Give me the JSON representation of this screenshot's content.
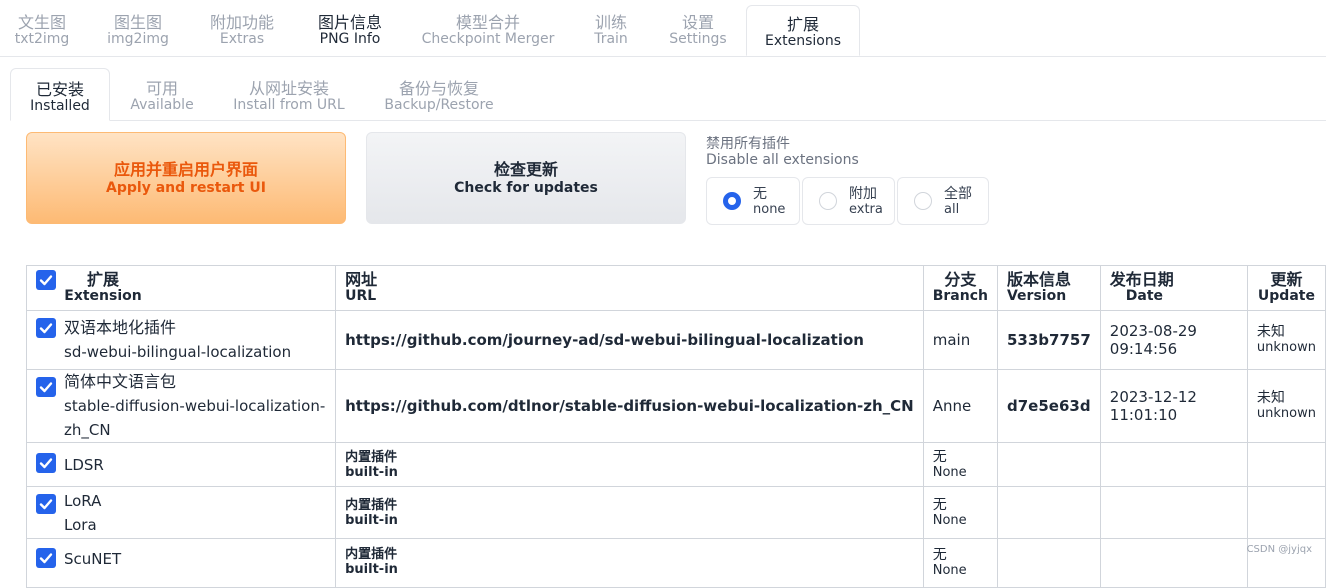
{
  "top_tabs": [
    {
      "cn": "文生图",
      "en": "txt2img"
    },
    {
      "cn": "图生图",
      "en": "img2img"
    },
    {
      "cn": "附加功能",
      "en": "Extras"
    },
    {
      "cn": "图片信息",
      "en": "PNG Info"
    },
    {
      "cn": "模型合并",
      "en": "Checkpoint Merger"
    },
    {
      "cn": "训练",
      "en": "Train"
    },
    {
      "cn": "设置",
      "en": "Settings"
    },
    {
      "cn": "扩展",
      "en": "Extensions"
    }
  ],
  "sub_tabs": [
    {
      "cn": "已安装",
      "en": "Installed"
    },
    {
      "cn": "可用",
      "en": "Available"
    },
    {
      "cn": "从网址安装",
      "en": "Install from URL"
    },
    {
      "cn": "备份与恢复",
      "en": "Backup/Restore"
    }
  ],
  "apply_button": {
    "cn": "应用并重启用户界面",
    "en": "Apply and restart UI"
  },
  "check_button": {
    "cn": "检查更新",
    "en": "Check for updates"
  },
  "disable_label": {
    "cn": "禁用所有插件",
    "en": "Disable all extensions"
  },
  "disable_options": [
    {
      "cn": "无",
      "en": "none",
      "checked": true
    },
    {
      "cn": "附加",
      "en": "extra",
      "checked": false
    },
    {
      "cn": "全部",
      "en": "all",
      "checked": false
    }
  ],
  "table": {
    "headers": {
      "extension": {
        "cn": "扩展",
        "en": "Extension"
      },
      "url": {
        "cn": "网址",
        "en": "URL"
      },
      "branch": {
        "cn": "分支",
        "en": "Branch"
      },
      "version": {
        "cn": "版本信息",
        "en": "Version"
      },
      "date": {
        "cn": "发布日期",
        "en": "Date"
      },
      "update": {
        "cn": "更新",
        "en": "Update"
      }
    },
    "rows": [
      {
        "name": "双语本地化插件",
        "dir": "sd-webui-bilingual-localization",
        "url": "https://github.com/journey-ad/sd-webui-bilingual-localization",
        "branch": "main",
        "version": "533b7757",
        "date": "2023-08-29 09:14:56",
        "update_cn": "未知",
        "update_en": "unknown"
      },
      {
        "name": "简体中文语言包",
        "dir": "stable-diffusion-webui-localization-zh_CN",
        "url": "https://github.com/dtlnor/stable-diffusion-webui-localization-zh_CN",
        "branch": "Anne",
        "version": "d7e5e63d",
        "date": "2023-12-12 11:01:10",
        "update_cn": "未知",
        "update_en": "unknown"
      },
      {
        "name": "LDSR",
        "url_cn": "内置插件",
        "url_en": "built-in",
        "branch_cn": "无",
        "branch_en": "None"
      },
      {
        "name": "LoRA",
        "dir": "Lora",
        "url_cn": "内置插件",
        "url_en": "built-in",
        "branch_cn": "无",
        "branch_en": "None"
      },
      {
        "name": "ScuNET",
        "url_cn": "内置插件",
        "url_en": "built-in",
        "branch_cn": "无",
        "branch_en": "None"
      }
    ]
  },
  "watermark": "CSDN @jyjqx",
  "colors": {
    "accent": "#2563eb",
    "apply_text": "#ea580c",
    "apply_bg": "#fdba74"
  }
}
